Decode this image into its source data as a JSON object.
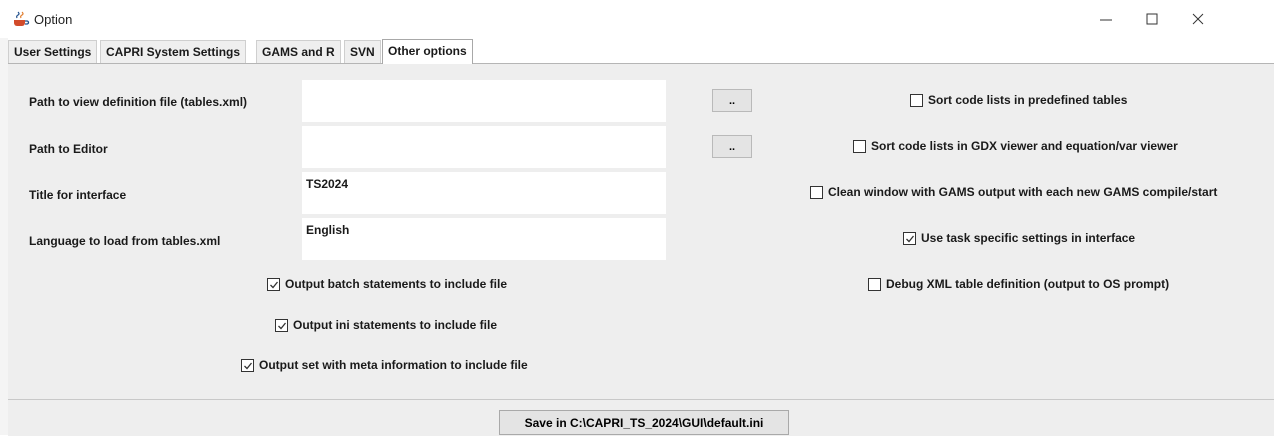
{
  "window": {
    "title": "Option",
    "app_icon": "java-cup-icon",
    "controls": [
      "minimize-icon",
      "maximize-icon",
      "close-icon"
    ]
  },
  "tabs": [
    {
      "label": "User Settings",
      "active": false
    },
    {
      "label": "CAPRI System Settings",
      "active": false
    },
    {
      "label": "GAMS and R",
      "active": false
    },
    {
      "label": "SVN",
      "active": false
    },
    {
      "label": "Other options",
      "active": true
    }
  ],
  "form": {
    "view_def_label": "Path to view definition file (tables.xml)",
    "view_def_value": "",
    "editor_label": "Path to Editor",
    "editor_value": "",
    "title_label": "Title for interface",
    "title_value": "TS2024",
    "language_label": "Language to load from tables.xml",
    "language_value": "English",
    "browse_label": ".."
  },
  "checkboxes_left": [
    {
      "label": "Output batch statements to include file",
      "checked": true
    },
    {
      "label": "Output ini statements to include file",
      "checked": true
    },
    {
      "label": "Output set with meta information to include file",
      "checked": true
    }
  ],
  "checkboxes_right": [
    {
      "label": "Sort code lists in predefined tables",
      "checked": false
    },
    {
      "label": "Sort code lists in GDX viewer and equation/var viewer",
      "checked": false
    },
    {
      "label": "Clean window with GAMS output with each new GAMS compile/start",
      "checked": false
    },
    {
      "label": "Use task specific settings in interface",
      "checked": true
    },
    {
      "label": "Debug XML table definition (output to OS prompt)",
      "checked": false
    }
  ],
  "footer": {
    "save_label": "Save in C:\\CAPRI_TS_2024\\GUI\\default.ini"
  },
  "colors": {
    "panel": "#eeeeee",
    "field": "#ffffff",
    "button": "#e4e4e4"
  }
}
